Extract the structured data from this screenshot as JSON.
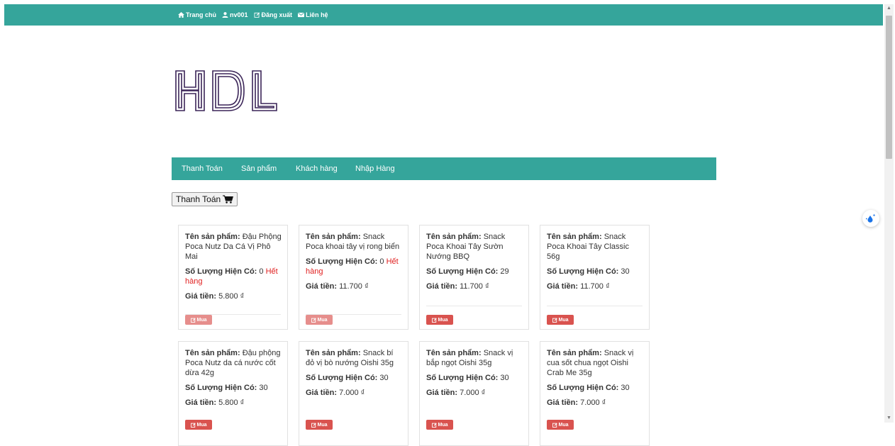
{
  "topnav": {
    "home": "Trang chủ",
    "user": "nv001",
    "logout": "Đăng xuất",
    "contact": "Liên hệ"
  },
  "logo": {
    "text": "HDL"
  },
  "mainnav": [
    "Thanh Toán",
    "Sản phẩm",
    "Khách hàng",
    "Nhập Hàng"
  ],
  "pay_button": {
    "label": "Thanh Toán"
  },
  "labels": {
    "name": "Tên sản phẩm:",
    "qty": "Số Lượng Hiện Có:",
    "price": "Giá tiền:",
    "buy": "Mua",
    "out_of_stock": "Hết hàng"
  },
  "products": [
    {
      "name": "Đậu Phộng Poca Nutz Da Cá Vị Phô Mai",
      "qty": "0",
      "out_of_stock": true,
      "price": "5.800 ₫"
    },
    {
      "name": "Snack Poca khoai tây vị rong biển",
      "qty": "0",
      "out_of_stock": true,
      "price": "11.700 ₫"
    },
    {
      "name": "Snack Poca Khoai Tây Sườn Nướng BBQ",
      "qty": "29",
      "out_of_stock": false,
      "price": "11.700 ₫"
    },
    {
      "name": "Snack Poca Khoai Tây Classic 56g",
      "qty": "30",
      "out_of_stock": false,
      "price": "11.700 ₫"
    },
    {
      "name": "Đậu phộng Poca Nutz da cá nước cốt dừa 42g",
      "qty": "30",
      "out_of_stock": false,
      "price": "5.800 ₫"
    },
    {
      "name": "Snack bí đỏ vị bò nướng Oishi 35g",
      "qty": "30",
      "out_of_stock": false,
      "price": "7.000 ₫"
    },
    {
      "name": "Snack vị bắp ngọt Oishi 35g",
      "qty": "30",
      "out_of_stock": false,
      "price": "7.000 ₫"
    },
    {
      "name": "Snack vị cua sốt chua ngọt Oishi Crab Me 35g",
      "qty": "30",
      "out_of_stock": false,
      "price": "7.000 ₫"
    }
  ],
  "colors": {
    "teal": "#35a59b",
    "buy": "#d9534f",
    "out_of_stock": "#e02020",
    "logo": "#3b2558"
  }
}
